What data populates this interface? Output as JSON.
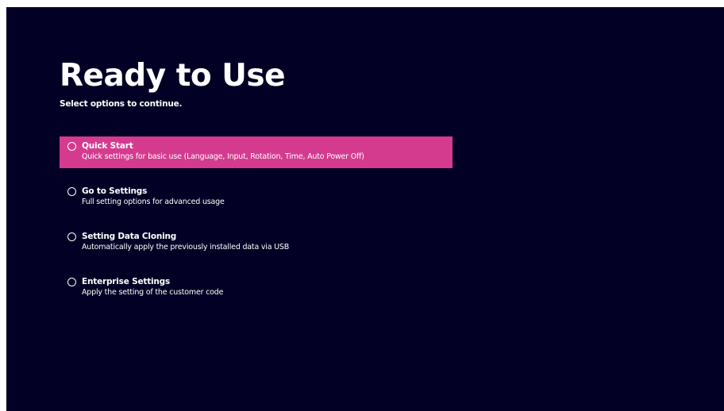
{
  "screen": {
    "title": "Ready to Use",
    "subtitle": "Select options to continue."
  },
  "colors": {
    "background": "#020024",
    "selected_highlight": "#d43b8f",
    "text": "#ffffff"
  },
  "options": [
    {
      "title": "Quick Start",
      "description": "Quick settings for basic use (Language, Input, Rotation, Time, Auto Power Off)",
      "selected": true,
      "icon": "radio-unchecked-icon"
    },
    {
      "title": "Go to Settings",
      "description": "Full setting options for advanced usage",
      "selected": false,
      "icon": "radio-unchecked-icon"
    },
    {
      "title": "Setting Data Cloning",
      "description": "Automatically apply the previously installed data via USB",
      "selected": false,
      "icon": "radio-unchecked-icon"
    },
    {
      "title": "Enterprise Settings",
      "description": "Apply the setting of the customer code",
      "selected": false,
      "icon": "radio-unchecked-icon"
    }
  ]
}
